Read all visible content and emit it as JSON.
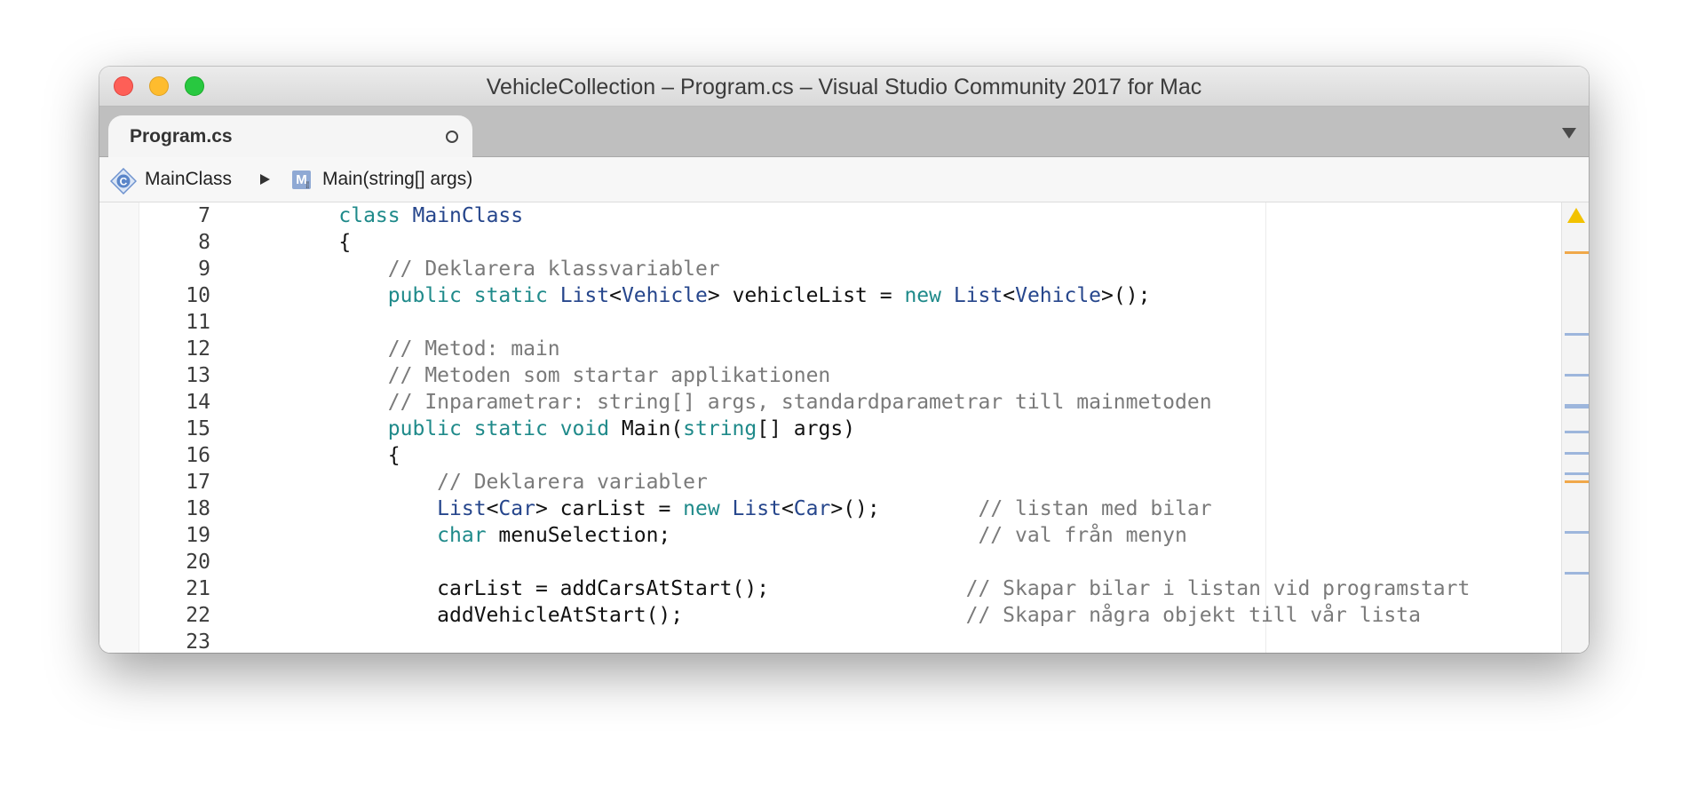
{
  "window": {
    "title": "VehicleCollection – Program.cs – Visual Studio Community 2017 for Mac"
  },
  "tabs": [
    {
      "label": "Program.cs",
      "active": true,
      "modified_indicator": "circle-icon"
    }
  ],
  "breadcrumb": {
    "class_icon": "class-icon",
    "class_icon_letter": "C",
    "class_name": "MainClass",
    "separator_icon": "triangle-right-icon",
    "method_icon": "method-icon",
    "method_icon_letter": "M",
    "method_name": "Main(string[] args)"
  },
  "colors": {
    "keyword": "#1f8a8a",
    "type": "#26468c",
    "comment": "#7a7a7a",
    "plain": "#111111",
    "warning": "#f2c200",
    "scroll_marker_orange": "#f0a84a",
    "scroll_marker_blue": "#9db6dc"
  },
  "editor": {
    "lines": [
      {
        "number": "7",
        "tokens": [
          [
            "plain",
            "    "
          ],
          [
            "kw",
            "class"
          ],
          [
            "plain",
            " "
          ],
          [
            "type",
            "MainClass"
          ]
        ]
      },
      {
        "number": "8",
        "tokens": [
          [
            "plain",
            "    {"
          ]
        ]
      },
      {
        "number": "9",
        "tokens": [
          [
            "plain",
            "        "
          ],
          [
            "comment",
            "// Deklarera klassvariabler"
          ]
        ]
      },
      {
        "number": "10",
        "tokens": [
          [
            "plain",
            "        "
          ],
          [
            "kw",
            "public"
          ],
          [
            "plain",
            " "
          ],
          [
            "kw",
            "static"
          ],
          [
            "plain",
            " "
          ],
          [
            "type",
            "List"
          ],
          [
            "plain",
            "<"
          ],
          [
            "type",
            "Vehicle"
          ],
          [
            "plain",
            "> vehicleList = "
          ],
          [
            "kw",
            "new"
          ],
          [
            "plain",
            " "
          ],
          [
            "type",
            "List"
          ],
          [
            "plain",
            "<"
          ],
          [
            "type",
            "Vehicle"
          ],
          [
            "plain",
            ">();"
          ]
        ]
      },
      {
        "number": "11",
        "tokens": []
      },
      {
        "number": "12",
        "tokens": [
          [
            "plain",
            "        "
          ],
          [
            "comment",
            "// Metod: main"
          ]
        ]
      },
      {
        "number": "13",
        "tokens": [
          [
            "plain",
            "        "
          ],
          [
            "comment",
            "// Metoden som startar applikationen"
          ]
        ]
      },
      {
        "number": "14",
        "tokens": [
          [
            "plain",
            "        "
          ],
          [
            "comment",
            "// Inparametrar: string[] args, standardparametrar till mainmetoden"
          ]
        ]
      },
      {
        "number": "15",
        "tokens": [
          [
            "plain",
            "        "
          ],
          [
            "kw",
            "public"
          ],
          [
            "plain",
            " "
          ],
          [
            "kw",
            "static"
          ],
          [
            "plain",
            " "
          ],
          [
            "kw",
            "void"
          ],
          [
            "plain",
            " Main("
          ],
          [
            "kw",
            "string"
          ],
          [
            "plain",
            "[] args)"
          ]
        ]
      },
      {
        "number": "16",
        "tokens": [
          [
            "plain",
            "        {"
          ]
        ]
      },
      {
        "number": "17",
        "tokens": [
          [
            "plain",
            "            "
          ],
          [
            "comment",
            "// Deklarera variabler"
          ]
        ]
      },
      {
        "number": "18",
        "tokens": [
          [
            "plain",
            "            "
          ],
          [
            "type",
            "List"
          ],
          [
            "plain",
            "<"
          ],
          [
            "type",
            "Car"
          ],
          [
            "plain",
            "> carList = "
          ],
          [
            "kw",
            "new"
          ],
          [
            "plain",
            " "
          ],
          [
            "type",
            "List"
          ],
          [
            "plain",
            "<"
          ],
          [
            "type",
            "Car"
          ],
          [
            "plain",
            ">();        "
          ],
          [
            "comment",
            "// listan med bilar"
          ]
        ]
      },
      {
        "number": "19",
        "tokens": [
          [
            "plain",
            "            "
          ],
          [
            "kw",
            "char"
          ],
          [
            "plain",
            " menuSelection;                         "
          ],
          [
            "comment",
            "// val från menyn"
          ]
        ]
      },
      {
        "number": "20",
        "tokens": []
      },
      {
        "number": "21",
        "tokens": [
          [
            "plain",
            "            carList = addCarsAtStart();                "
          ],
          [
            "comment",
            "// Skapar bilar i listan vid programstart"
          ]
        ]
      },
      {
        "number": "22",
        "tokens": [
          [
            "plain",
            "            addVehicleAtStart();                       "
          ],
          [
            "comment",
            "// Skapar några objekt till vår lista"
          ]
        ]
      },
      {
        "number": "23",
        "tokens": []
      }
    ]
  },
  "overview_ruler": {
    "warning_icon": "warning-triangle-icon"
  }
}
